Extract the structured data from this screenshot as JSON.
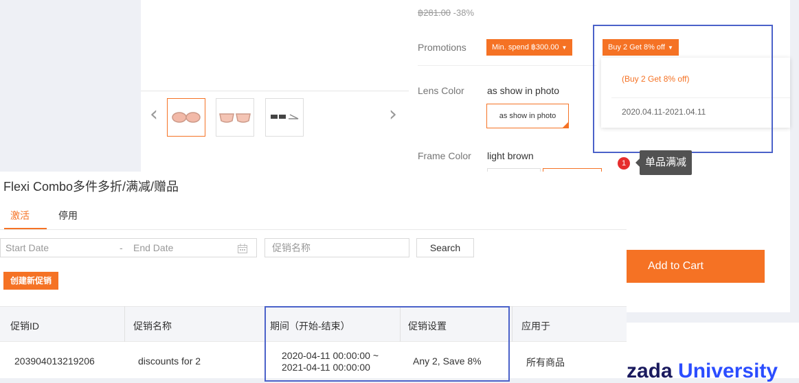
{
  "product": {
    "old_price": "฿281.00",
    "discount": "-38%",
    "promotions_label": "Promotions",
    "promo_tags": [
      "Min. spend ฿300.00",
      "Buy 2 Get 8% off"
    ],
    "popup": {
      "title": "(Buy 2 Get 8% off)",
      "period": "2020.04.11-2021.04.11"
    },
    "lens_color_label": "Lens Color",
    "lens_color_value": "as show in photo",
    "lens_color_chip": "as show in photo",
    "frame_color_label": "Frame Color",
    "frame_color_value": "light brown",
    "add_to_cart": "Add to Cart"
  },
  "annotation": {
    "number": "1",
    "label": "单品满减"
  },
  "seller": {
    "title": "Flexi Combo多件多折/满减/赠品",
    "tabs": [
      {
        "label": "激活",
        "active": true
      },
      {
        "label": "停用",
        "active": false
      }
    ],
    "start_date_placeholder": "Start Date",
    "date_separator": "-",
    "end_date_placeholder": "End Date",
    "name_placeholder": "促销名称",
    "search_button": "Search",
    "create_button": "创建新促销",
    "columns": [
      "促销ID",
      "促销名称",
      "期间（开始-结束）",
      "促销设置",
      "应用于"
    ],
    "rows": [
      {
        "id": "203904013219206",
        "name": "discounts for 2",
        "period_start": "2020-04-11 00:00:00 ~",
        "period_end": "2021-04-11 00:00:00",
        "setting": "Any 2, Save 8%",
        "applies_to": "所有商品"
      }
    ]
  },
  "university": {
    "part1": "zada ",
    "part2": "University"
  },
  "colors": {
    "accent": "#f57224",
    "highlight": "#4a61c9",
    "badge": "#e62d2d"
  }
}
